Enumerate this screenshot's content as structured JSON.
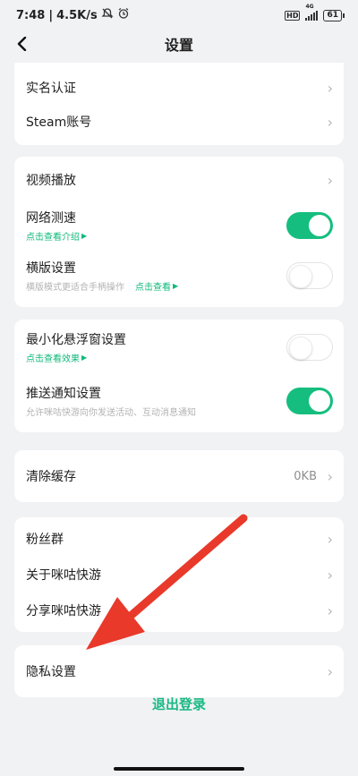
{
  "status_bar": {
    "time": "7:48",
    "speed": "4.5K/s",
    "hd_badge": "HD",
    "network_label": "4G",
    "battery": "61"
  },
  "header": {
    "title": "设置"
  },
  "sections": {
    "account": {
      "realname_label": "实名认证",
      "steam_label": "Steam账号"
    },
    "video": {
      "playback_label": "视频播放",
      "network_test_label": "网络测速",
      "network_test_link": "点击查看介绍",
      "network_test_on": true,
      "landscape_label": "横版设置",
      "landscape_desc": "横版模式更适合手柄操作",
      "landscape_link": "点击查看",
      "landscape_on": false
    },
    "notify": {
      "float_label": "最小化悬浮窗设置",
      "float_link": "点击查看效果",
      "float_on": false,
      "push_label": "推送通知设置",
      "push_desc": "允许咪咕快游向你发送活动、互动消息通知",
      "push_on": true
    },
    "cache": {
      "clear_label": "清除缓存",
      "cache_value": "0KB"
    },
    "about": {
      "fans_label": "粉丝群",
      "about_label": "关于咪咕快游",
      "share_label": "分享咪咕快游"
    },
    "privacy": {
      "privacy_label": "隐私设置"
    }
  },
  "logout_label": "退出登录",
  "colors": {
    "accent": "#15be7e",
    "annotation_arrow": "#e8392b"
  }
}
